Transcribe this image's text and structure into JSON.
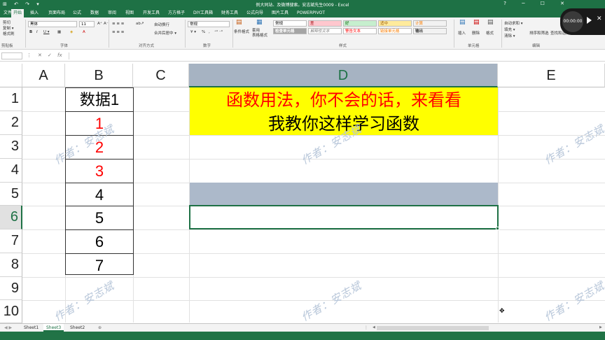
{
  "window": {
    "title": "例大同站、及微博搜索。安志斌先生0009 - Excel",
    "qat_icons": "⊞ ↶ ↷ ▾"
  },
  "tabs": [
    "文件",
    "开始",
    "插入",
    "页面布局",
    "公式",
    "数据",
    "审阅",
    "视图",
    "开发工具",
    "方方格子",
    "DIY工具箱",
    "财务工具",
    "公式向导",
    "图片工具",
    "POWERPIVOT"
  ],
  "ribbon": {
    "clipboard": {
      "cut": "剪切",
      "copy": "复制 ▾",
      "format_painter": "格式刷",
      "paste": "粘贴",
      "group": "剪贴板"
    },
    "font": {
      "name": "黑体",
      "size": "11",
      "grow": "A⁺",
      "shrink": "A⁻",
      "bold": "B",
      "italic": "I",
      "underline": "U ▾",
      "group": "字体"
    },
    "alignment": {
      "wrap": "自动换行",
      "merge": "合并后居中 ▾",
      "group": "对齐方式"
    },
    "number": {
      "format": "常规",
      "percent": "%",
      "comma": ",",
      "group": "数字"
    },
    "styles": {
      "conditional": "条件格式",
      "table": "套用\n表格格式",
      "cells": [
        "常规",
        "差",
        "好",
        "适中",
        "计算",
        "检查单元格",
        "解释性文本",
        "警告文本",
        "链接单元格",
        "输出"
      ],
      "group": "样式"
    },
    "cells_group": {
      "insert": "插入",
      "delete": "删除",
      "format": "格式",
      "group": "单元格"
    },
    "editing": {
      "autosum": "自动求和 ▾",
      "fill": "填充 ▾",
      "clear": "清除 ▾",
      "sort": "排序和筛选",
      "find": "查找和选择",
      "group": "编辑"
    }
  },
  "formula_bar": {
    "name_box": "",
    "cancel": "✕",
    "enter": "✓",
    "fx": "fx"
  },
  "columns": [
    "A",
    "B",
    "C",
    "D",
    "E"
  ],
  "rows": [
    "1",
    "2",
    "3",
    "4",
    "5",
    "6",
    "7",
    "8",
    "9",
    "10"
  ],
  "cells": {
    "B1": "数据1",
    "B2": "1",
    "B3": "2",
    "B4": "3",
    "B5": "4",
    "B6": "5",
    "B7": "6",
    "B8": "7",
    "D1": "函数用法，你不会的话，来看看",
    "D2": "我教你这样学习函数"
  },
  "watermark": "作者：安志斌",
  "sheets": [
    "Sheet1",
    "Sheet3",
    "Sheet2"
  ],
  "active_sheet": "Sheet3",
  "player": {
    "time": "00:00:00"
  },
  "colors": {
    "accent": "#1e7145",
    "highlight": "#ffff00",
    "red_text": "#ff0000",
    "selection_fill": "#a6b3c2"
  }
}
